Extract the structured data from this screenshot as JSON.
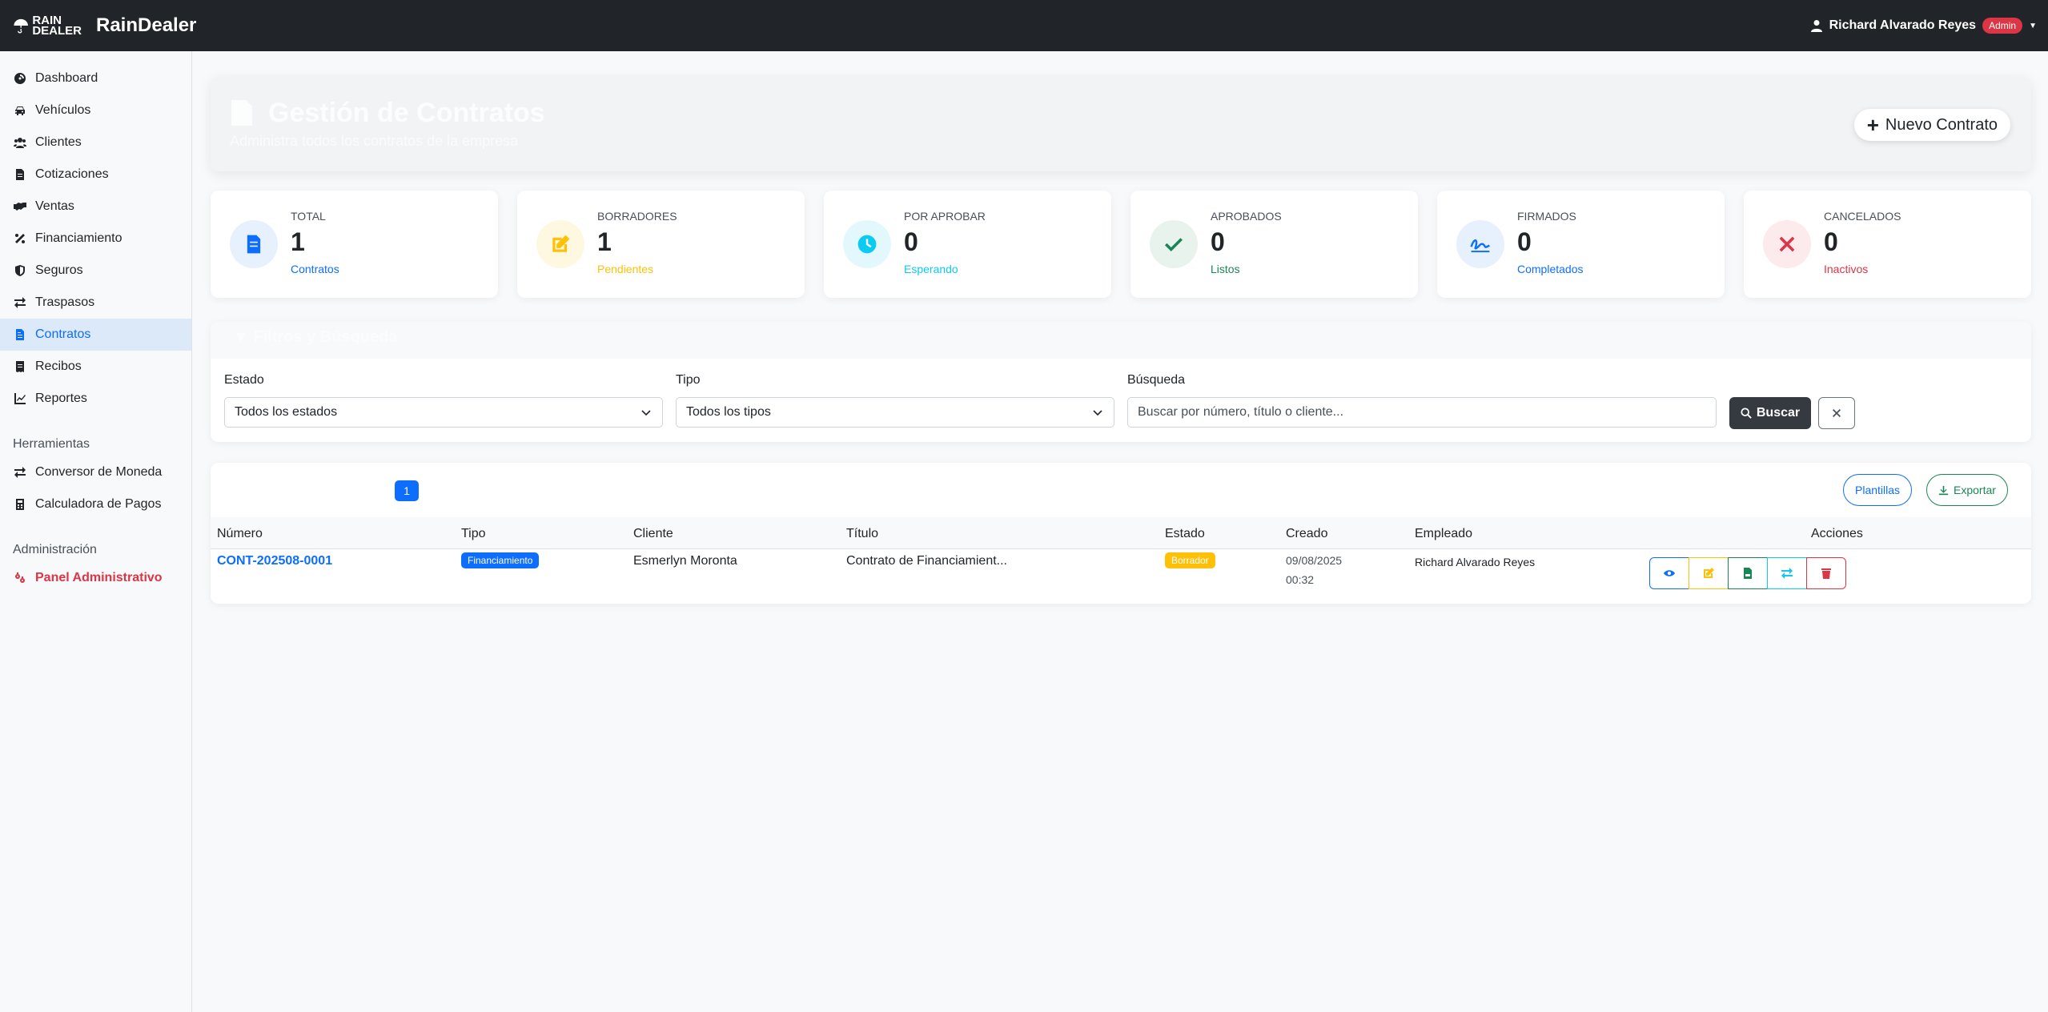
{
  "app": {
    "logo_text_line1": "RAIN",
    "logo_text_line2": "DEALER",
    "brand_name": "RainDealer",
    "user_name": "Richard Alvarado Reyes",
    "user_role_badge": "Admin"
  },
  "sidebar": {
    "items": [
      {
        "label": "Dashboard",
        "icon": "dashboard-icon"
      },
      {
        "label": "Vehículos",
        "icon": "car-icon"
      },
      {
        "label": "Clientes",
        "icon": "users-icon"
      },
      {
        "label": "Cotizaciones",
        "icon": "file-invoice-icon"
      },
      {
        "label": "Ventas",
        "icon": "handshake-icon"
      },
      {
        "label": "Financiamiento",
        "icon": "percent-icon"
      },
      {
        "label": "Seguros",
        "icon": "shield-icon"
      },
      {
        "label": "Traspasos",
        "icon": "exchange-icon"
      },
      {
        "label": "Contratos",
        "icon": "file-contract-icon",
        "active": true
      },
      {
        "label": "Recibos",
        "icon": "receipt-icon"
      },
      {
        "label": "Reportes",
        "icon": "chart-line-icon"
      }
    ],
    "tools_heading": "Herramientas",
    "tools": [
      {
        "label": "Conversor de Moneda",
        "icon": "exchange-icon"
      },
      {
        "label": "Calculadora de Pagos",
        "icon": "calculator-icon"
      }
    ],
    "admin_heading": "Administración",
    "admin_item": {
      "label": "Panel Administrativo",
      "icon": "cogs-icon"
    }
  },
  "header": {
    "title": "Gestión de Contratos",
    "subtitle": "Administra todos los contratos de la empresa",
    "new_button": "Nuevo Contrato"
  },
  "stats": [
    {
      "label": "TOTAL",
      "value": "1",
      "sub": "Contratos",
      "color": "#0d6efd",
      "bg": "#e7f0fd",
      "icon": "file-contract-icon"
    },
    {
      "label": "BORRADORES",
      "value": "1",
      "sub": "Pendientes",
      "color": "#ffc107",
      "bg": "#fff8e1",
      "icon": "edit-icon"
    },
    {
      "label": "POR APROBAR",
      "value": "0",
      "sub": "Esperando",
      "color": "#0dcaf0",
      "bg": "#e3f8fc",
      "icon": "clock-icon"
    },
    {
      "label": "APROBADOS",
      "value": "0",
      "sub": "Listos",
      "color": "#198754",
      "bg": "#e8f3ee",
      "icon": "check-icon"
    },
    {
      "label": "FIRMADOS",
      "value": "0",
      "sub": "Completados",
      "color": "#0d6efd",
      "bg": "#e7f0fd",
      "icon": "signature-icon"
    },
    {
      "label": "CANCELADOS",
      "value": "0",
      "sub": "Inactivos",
      "color": "#dc3545",
      "bg": "#fceaec",
      "icon": "times-icon"
    }
  ],
  "filters": {
    "heading": "Filtros y Búsqueda",
    "estado_label": "Estado",
    "estado_value": "Todos los estados",
    "tipo_label": "Tipo",
    "tipo_value": "Todos los tipos",
    "busqueda_label": "Búsqueda",
    "busqueda_placeholder": "Buscar por número, título o cliente...",
    "buscar_button": "Buscar"
  },
  "table": {
    "page": "1",
    "plantillas_button": "Plantillas",
    "exportar_button": "Exportar",
    "columns": [
      "Número",
      "Tipo",
      "Cliente",
      "Título",
      "Estado",
      "Creado",
      "Empleado",
      "Acciones"
    ],
    "rows": [
      {
        "numero": "CONT-202508-0001",
        "tipo": "Financiamiento",
        "cliente": "Esmerlyn Moronta",
        "titulo": "Contrato de Financiamient...",
        "estado": "Borrador",
        "creado_fecha": "09/08/2025",
        "creado_hora": "00:32",
        "empleado": "Richard Alvarado Reyes"
      }
    ]
  }
}
